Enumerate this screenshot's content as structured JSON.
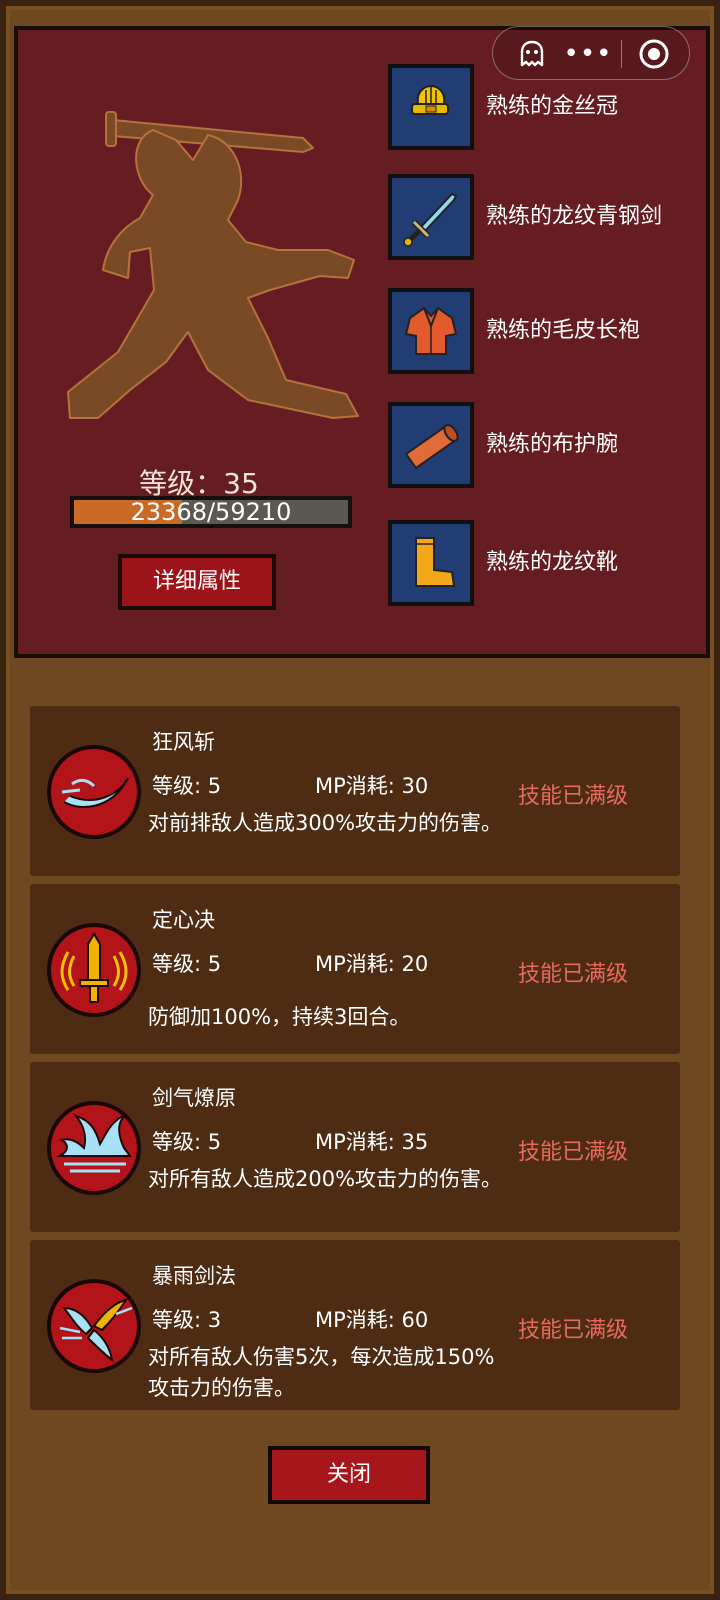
{
  "capsule": {
    "menu": "•••"
  },
  "character": {
    "level_label": "等级：35",
    "exp_text": "23368/59210",
    "exp_current": 23368,
    "exp_max": 59210,
    "detail_button": "详细属性"
  },
  "equipment": [
    {
      "name": "熟练的金丝冠",
      "icon": "crown-icon"
    },
    {
      "name": "熟练的龙纹青钢剑",
      "icon": "sword-icon"
    },
    {
      "name": "熟练的毛皮长袍",
      "icon": "robe-icon"
    },
    {
      "name": "熟练的布护腕",
      "icon": "bracer-icon"
    },
    {
      "name": "熟练的龙纹靴",
      "icon": "boot-icon"
    }
  ],
  "skills": [
    {
      "name": "狂风斩",
      "level": "等级: 5",
      "mp": "MP消耗: 30",
      "status": "技能已满级",
      "desc": "对前排敌人造成300%攻击力的伤害。",
      "icon": "wind-slash-icon"
    },
    {
      "name": "定心决",
      "level": "等级: 5",
      "mp": "MP消耗: 20",
      "status": "技能已满级",
      "desc": "防御加100%，持续3回合。",
      "icon": "sword-shield-icon"
    },
    {
      "name": "剑气燎原",
      "level": "等级: 5",
      "mp": "MP消耗: 35",
      "status": "技能已满级",
      "desc": "对所有敌人造成200%攻击力的伤害。",
      "icon": "sword-wave-icon"
    },
    {
      "name": "暴雨剑法",
      "level": "等级: 3",
      "mp": "MP消耗: 60",
      "status": "技能已满级",
      "desc": "对所有敌人伤害5次，每次造成150%攻击力的伤害。",
      "icon": "storm-blade-icon"
    }
  ],
  "close_button": "关闭",
  "colors": {
    "panel": "#651d22",
    "wood": "#6e4820",
    "skill_card": "#4d2c13",
    "status": "#e86a5d",
    "button": "#9c1419",
    "slot": "#213d74"
  }
}
